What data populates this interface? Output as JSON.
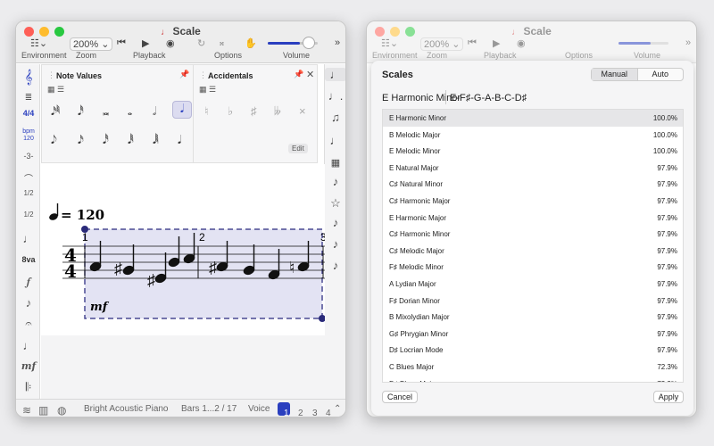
{
  "left_window": {
    "title": "Scale",
    "toolbar": {
      "environment_label": "Environment",
      "zoom_label": "Zoom",
      "zoom_value": "200%",
      "playback_label": "Playback",
      "options_label": "Options",
      "volume_label": "Volume",
      "volume_level": 0.65
    },
    "palettes": {
      "note_values": {
        "title": "Note Values",
        "glyphs_row1": [
          "𝅘𝅥𝅯𝅱",
          "𝅘𝅥𝅰",
          "𝅜",
          "𝅝",
          "𝅗𝅥",
          "𝅘𝅥"
        ],
        "glyphs_row2": [
          "𝅘𝅥𝅮",
          "𝅘𝅥𝅯",
          "𝅘𝅥𝅰",
          "𝅘𝅥𝅱",
          "𝅘𝅥𝅲",
          "𝅘𝅥𝅳"
        ]
      },
      "accidentals": {
        "title": "Accidentals",
        "glyphs": [
          "♮",
          "♭",
          "♯",
          "𝄫",
          "×"
        ],
        "edit_label": "Edit"
      }
    },
    "left_sidebar": [
      "𝄞",
      "≣",
      "4/4",
      "bpm 120",
      "-3-",
      "⌒",
      "1/2",
      "1/2",
      "♩",
      "8va",
      "𝆑",
      "♪",
      "𝄐",
      "♩",
      "mf",
      "𝄆"
    ],
    "left_sidebar_labels": {
      "time": "4\n4",
      "bpm": "bpm",
      "bpm_value": "120",
      "octave": "8va",
      "dyn": "mf"
    },
    "right_sidebar": [
      "♩",
      "♩.",
      "♫",
      "♩",
      "▦",
      "♪",
      "☆",
      "♪",
      "♪",
      "♪"
    ],
    "score": {
      "tempo_value": "= 120",
      "time_sig_top": "4",
      "time_sig_bottom": "4",
      "measure_numbers": [
        "1",
        "2",
        "3"
      ],
      "dynamic": "mf"
    },
    "statusbar": {
      "instrument": "Bright Acoustic Piano",
      "bars": "Bars 1...2 / 17",
      "voice_label": "Voice",
      "voices": [
        "1",
        "2",
        "3",
        "4"
      ],
      "active_voice": "1"
    }
  },
  "right_window": {
    "title": "Scale",
    "toolbar": {
      "environment_label": "Environment",
      "zoom_label": "Zoom",
      "zoom_value": "200%",
      "playback_label": "Playback",
      "options_label": "Options",
      "volume_label": "Volume"
    },
    "sheet": {
      "title": "Scales",
      "modes": [
        "Manual",
        "Auto"
      ],
      "active_mode": "Manual",
      "current_scale": "E Harmonic Minor",
      "current_notes": "E-F♯-G-A-B-C-D♯",
      "scales": [
        {
          "name": "E  Harmonic Minor",
          "percent": "100.0%"
        },
        {
          "name": "B  Melodic Major",
          "percent": "100.0%"
        },
        {
          "name": "E  Melodic Minor",
          "percent": "100.0%"
        },
        {
          "name": "E  Natural Major",
          "percent": "97.9%"
        },
        {
          "name": "C♯  Natural Minor",
          "percent": "97.9%"
        },
        {
          "name": "C♯  Harmonic Major",
          "percent": "97.9%"
        },
        {
          "name": "E  Harmonic Major",
          "percent": "97.9%"
        },
        {
          "name": "C♯  Harmonic Minor",
          "percent": "97.9%"
        },
        {
          "name": "C♯  Melodic Major",
          "percent": "97.9%"
        },
        {
          "name": "F♯  Melodic Minor",
          "percent": "97.9%"
        },
        {
          "name": "A  Lydian Major",
          "percent": "97.9%"
        },
        {
          "name": "F♯  Dorian Minor",
          "percent": "97.9%"
        },
        {
          "name": "B  Mixolydian Major",
          "percent": "97.9%"
        },
        {
          "name": "G♯  Phrygian Minor",
          "percent": "97.9%"
        },
        {
          "name": "D♯  Locrian Mode",
          "percent": "97.9%"
        },
        {
          "name": "C  Blues Major",
          "percent": "72.3%"
        },
        {
          "name": "D♯  Blues Major",
          "percent": "72.3%"
        }
      ],
      "cancel_label": "Cancel",
      "apply_label": "Apply"
    }
  }
}
